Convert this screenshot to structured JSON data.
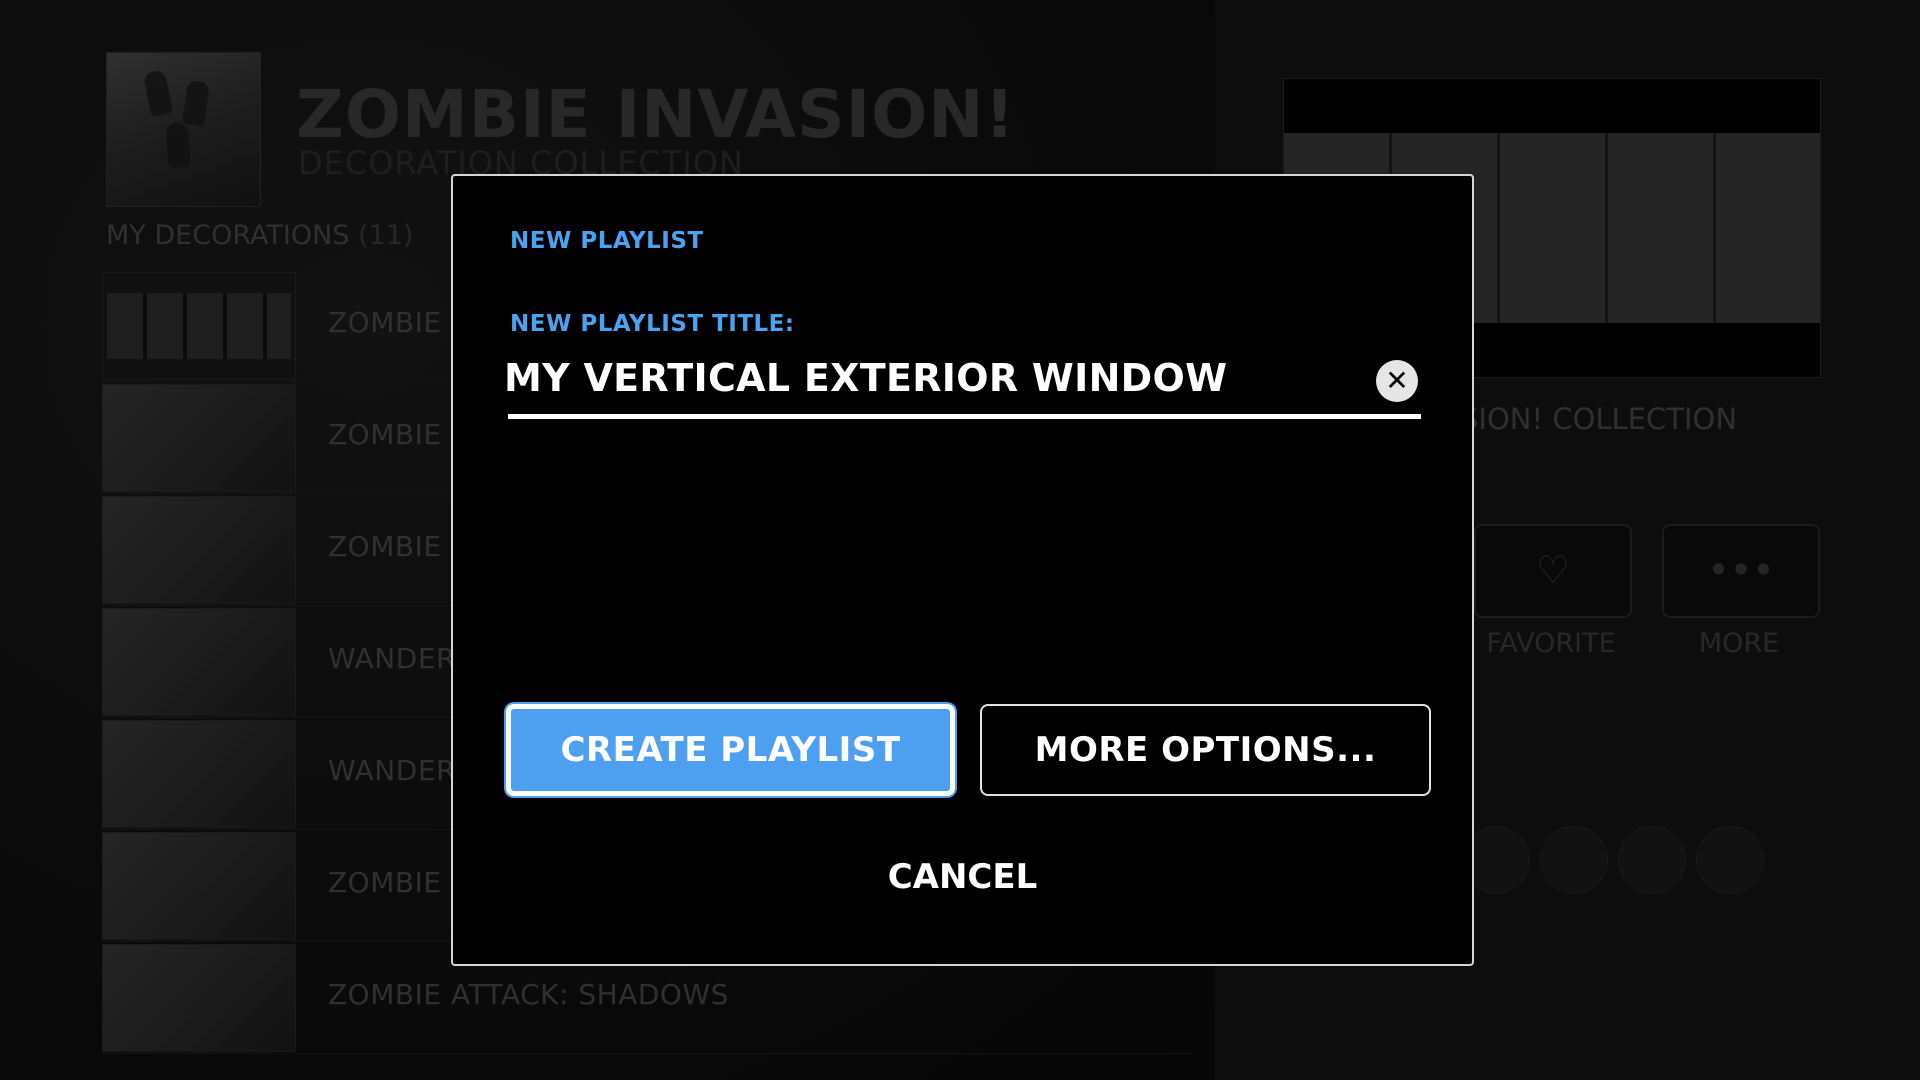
{
  "background": {
    "collection_title": "ZOMBIE INVASION!",
    "collection_subtitle": "DECORATION COLLECTION",
    "section_label": "MY DECORATIONS",
    "section_count": "(11)",
    "decorations": [
      {
        "label": "ZOMBIE"
      },
      {
        "label": "ZOMBIE"
      },
      {
        "label": "ZOMBIE"
      },
      {
        "label": "WANDER"
      },
      {
        "label": "WANDER"
      },
      {
        "label": "ZOMBIE"
      },
      {
        "label": "ZOMBIE ATTACK: SHADOWS"
      }
    ],
    "right_collection_label": "SION! COLLECTION",
    "actions": [
      {
        "label": "FAVORITE",
        "icon": "heart-icon"
      },
      {
        "label": "MORE",
        "icon": "more-dots-icon"
      }
    ]
  },
  "dialog": {
    "heading": "NEW PLAYLIST",
    "title_label": "NEW PLAYLIST TITLE:",
    "title_value": "MY VERTICAL EXTERIOR WINDOW",
    "clear_icon": "clear-x-icon",
    "create_label": "CREATE PLAYLIST",
    "more_options_label": "MORE OPTIONS...",
    "cancel_label": "CANCEL"
  },
  "colors": {
    "accent": "#4da0f0",
    "dialog_bg": "#000000",
    "page_bg": "#0d0d0d"
  }
}
